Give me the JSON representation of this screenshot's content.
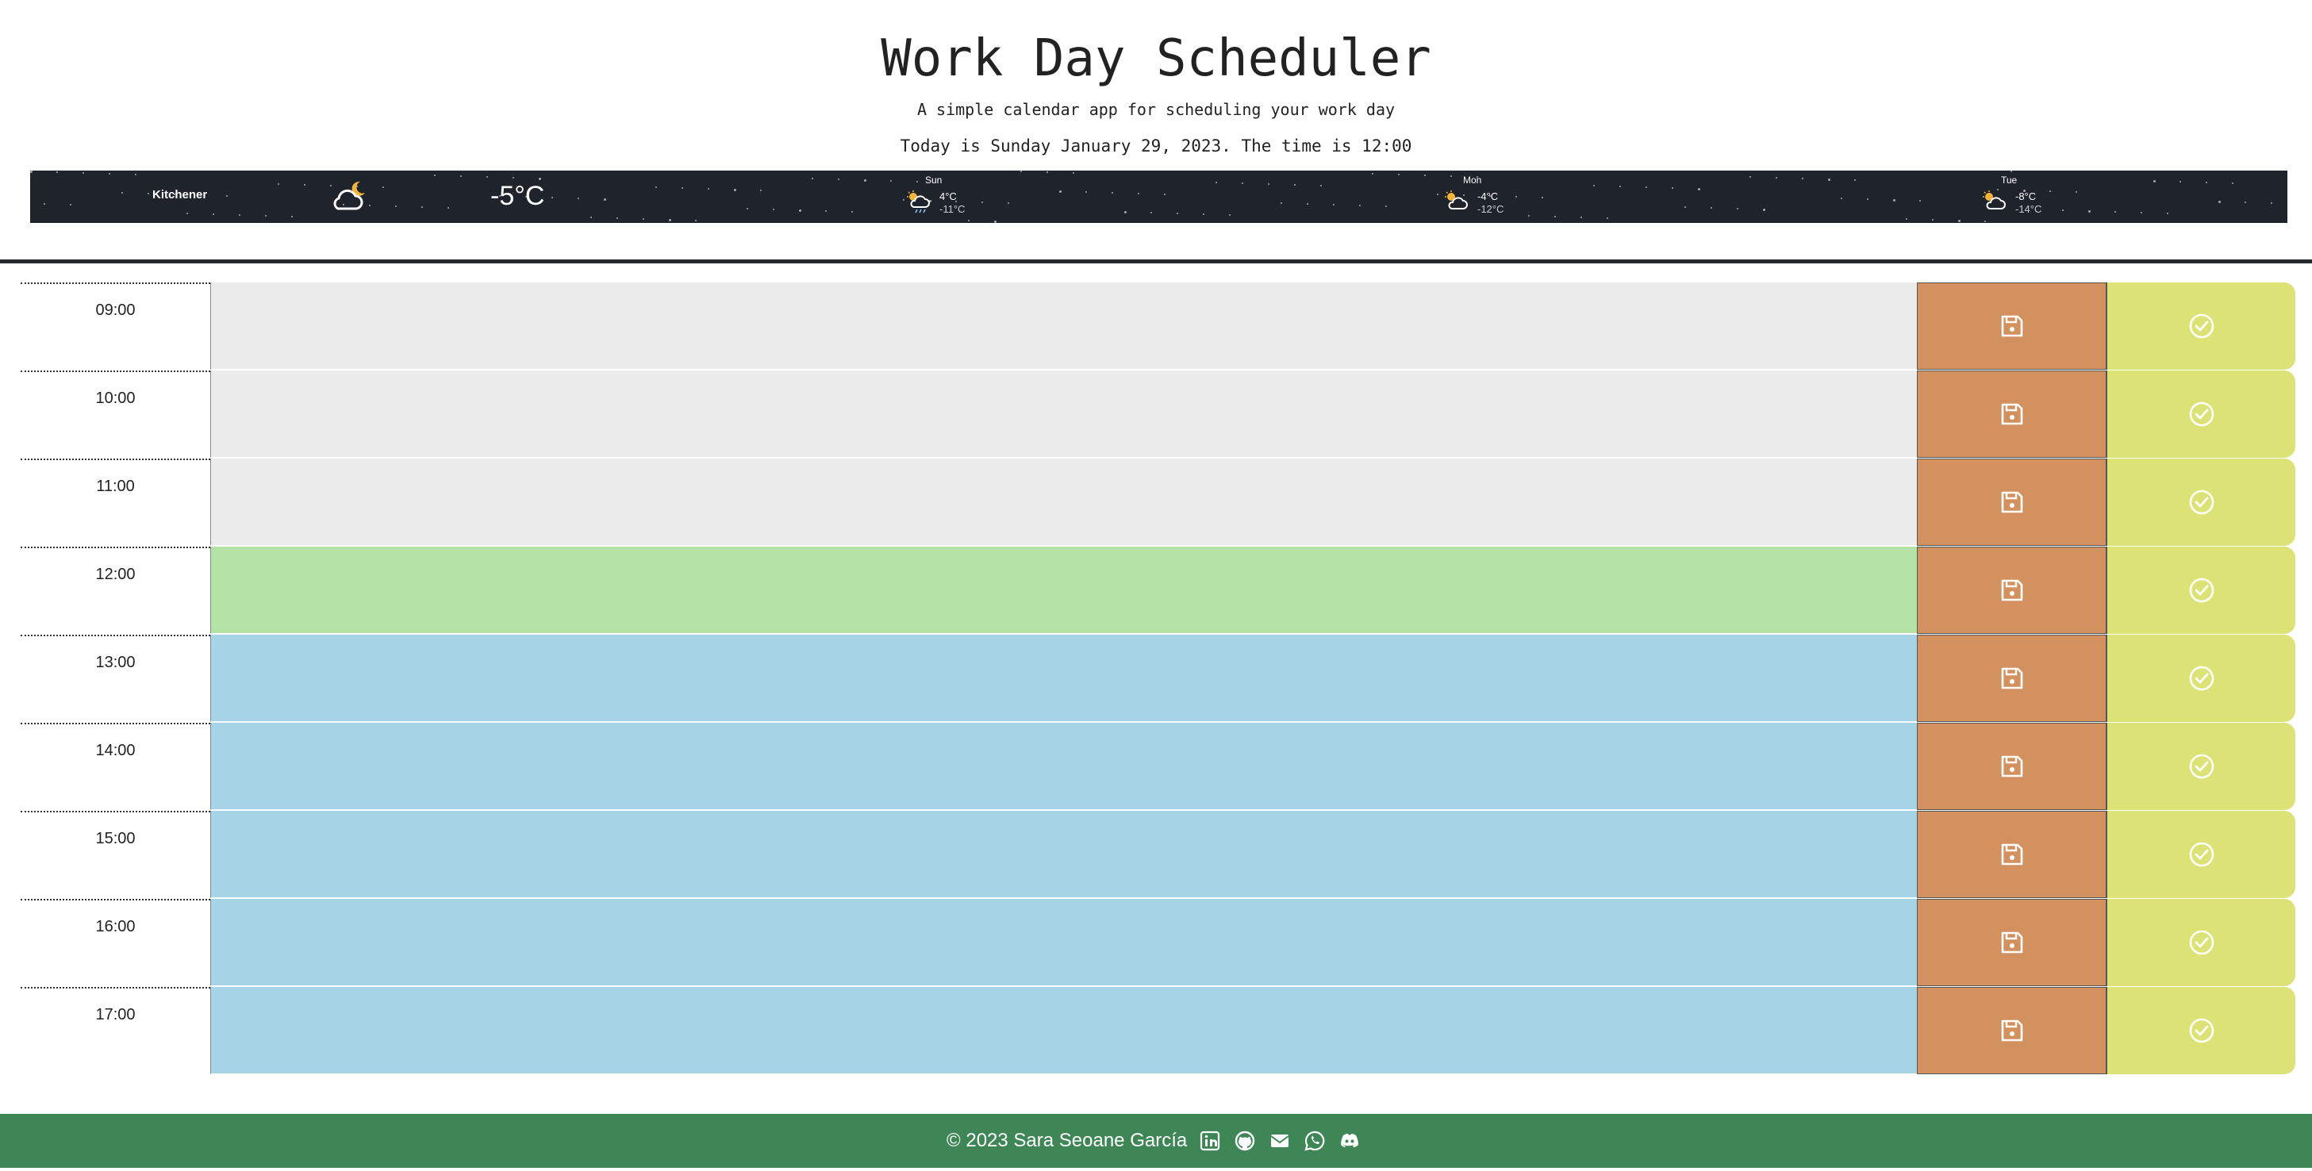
{
  "header": {
    "title": "Work Day Scheduler",
    "subtitle": "A simple calendar app for scheduling your work day",
    "today": "Today is Sunday January 29, 2023. The time is 12:00"
  },
  "weather": {
    "city": "Kitchener",
    "current_temp": "-5°C",
    "current_icon": "partly-cloudy-night-icon",
    "forecast": [
      {
        "day": "Sun",
        "high": "4°C",
        "low": "-11°C",
        "icon": "sun-cloud-rain-icon"
      },
      {
        "day": "Mon",
        "high": "-4°C",
        "low": "-12°C",
        "icon": "sun-cloud-icon"
      },
      {
        "day": "Tue",
        "high": "-8°C",
        "low": "-14°C",
        "icon": "sun-cloud-icon"
      }
    ]
  },
  "schedule": {
    "rows": [
      {
        "hour": "09:00",
        "state": "past",
        "text": ""
      },
      {
        "hour": "10:00",
        "state": "past",
        "text": ""
      },
      {
        "hour": "11:00",
        "state": "past",
        "text": ""
      },
      {
        "hour": "12:00",
        "state": "present",
        "text": ""
      },
      {
        "hour": "13:00",
        "state": "future",
        "text": ""
      },
      {
        "hour": "14:00",
        "state": "future",
        "text": ""
      },
      {
        "hour": "15:00",
        "state": "future",
        "text": ""
      },
      {
        "hour": "16:00",
        "state": "future",
        "text": ""
      },
      {
        "hour": "17:00",
        "state": "future",
        "text": ""
      }
    ],
    "save_icon": "floppy-disk-icon",
    "done_icon": "check-circle-icon"
  },
  "colors": {
    "past": "#ececec",
    "present": "#b4e3a5",
    "future": "#a6d4e6",
    "save": "#d49160",
    "done": "#dce276",
    "footer": "#3e8656",
    "weather_band": "#1f232b"
  },
  "footer": {
    "text": "© 2023 Sara Seoane García",
    "icons": [
      "linkedin-icon",
      "github-icon",
      "email-icon",
      "whatsapp-icon",
      "discord-icon"
    ]
  }
}
